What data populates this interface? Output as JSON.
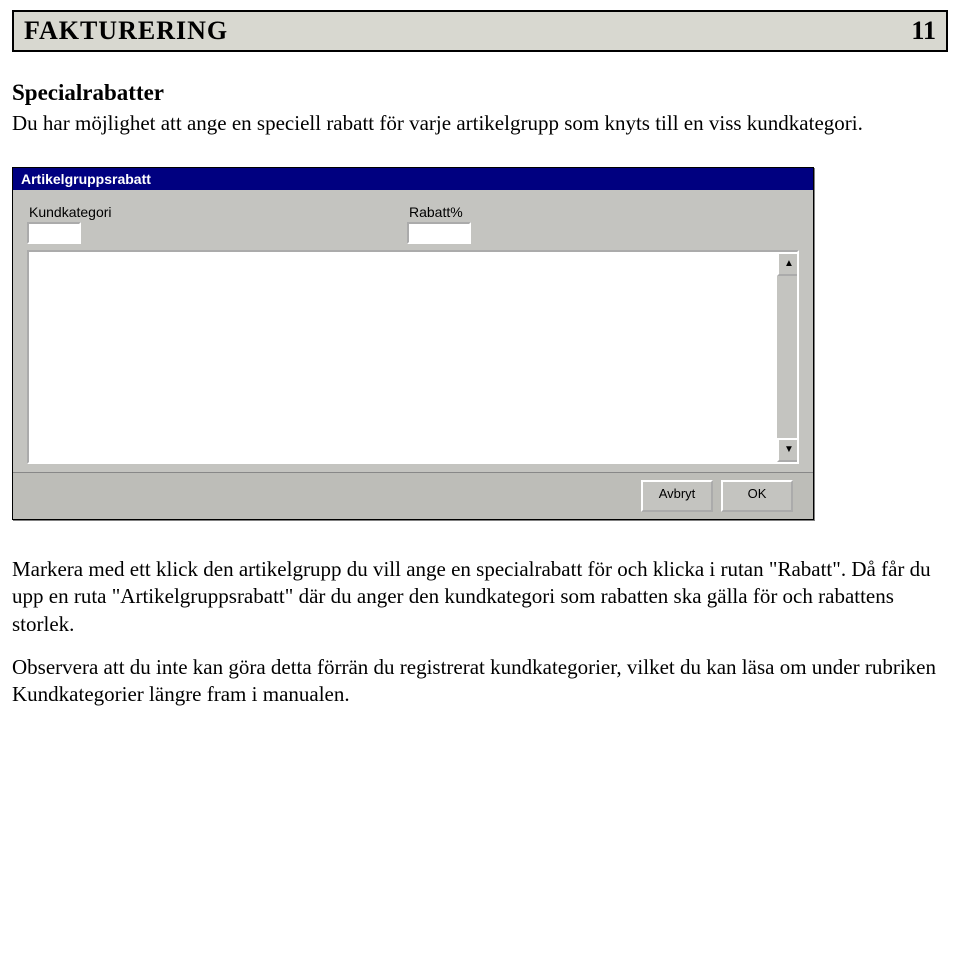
{
  "header": {
    "title": "FAKTURERING",
    "page_number": "11"
  },
  "section": {
    "heading": "Specialrabatter",
    "p1": "Du har möjlighet att ange en speciell rabatt för varje artikelgrupp som knyts till en viss kundkategori.",
    "p2": "Markera med ett klick den artikelgrupp du vill ange en specialrabatt för och klicka i rutan \"Rabatt\". Då får du upp en ruta \"Artikelgruppsrabatt\" där du anger den kundkategori som rabatten ska gälla för och rabattens storlek.",
    "p3": "Observera att du inte kan göra detta förrän du registrerat kundkategorier, vilket du kan läsa om under rubriken Kundkategorier längre fram i manualen."
  },
  "dialog": {
    "title": "Artikelgruppsrabatt",
    "field_kundkategori_label": "Kundkategori",
    "field_kundkategori_value": "",
    "field_rabatt_label": "Rabatt%",
    "field_rabatt_value": "",
    "buttons": {
      "cancel": "Avbryt",
      "ok": "OK"
    }
  }
}
